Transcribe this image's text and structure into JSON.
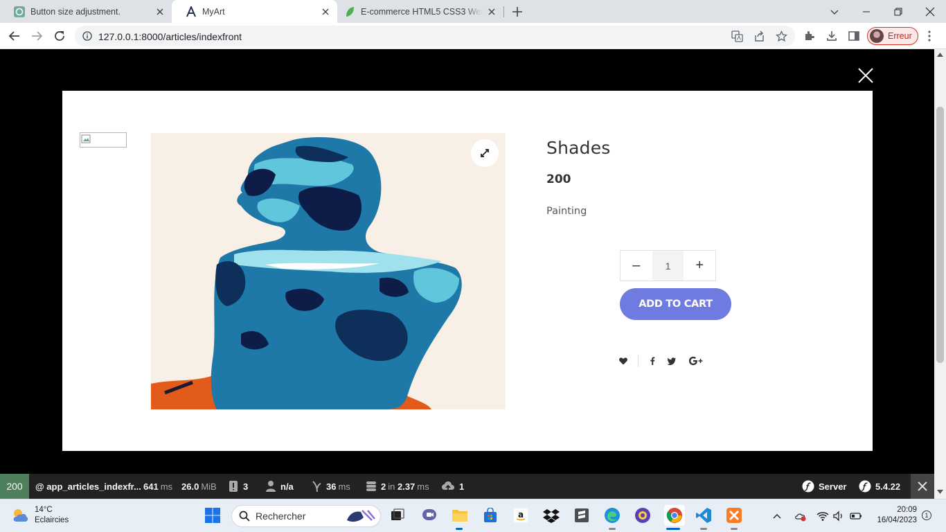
{
  "browser": {
    "tabs": [
      {
        "title": "Button size adjustment.",
        "icon": "chatgpt-icon"
      },
      {
        "title": "MyArt",
        "icon": "myart-icon"
      },
      {
        "title": "E-commerce HTML5 CSS3 Website",
        "icon": "leaf-icon"
      }
    ],
    "url_host": "127.0.0.1",
    "url_path": ":8000/articles/indexfront",
    "profile_label": "Erreur"
  },
  "product": {
    "title": "Shades",
    "price": "200",
    "category": "Painting",
    "quantity": "1",
    "minus_label": "–",
    "plus_label": "+",
    "add_to_cart_label": "ADD TO CART"
  },
  "devbar": {
    "status": "200",
    "route": "@ app_articles_indexfr...",
    "time_value": "641",
    "time_unit": "ms",
    "memory_value": "26.0",
    "memory_unit": "MiB",
    "logs_count": "3",
    "user": "n/a",
    "twig_value": "36",
    "twig_unit": "ms",
    "db_queries": "2",
    "db_in": "in",
    "db_time": "2.37",
    "db_unit": "ms",
    "http_count": "1",
    "server_label": "Server",
    "version": "5.4.22"
  },
  "taskbar": {
    "temperature": "14°C",
    "weather_text": "Eclaircies",
    "search_placeholder": "Rechercher",
    "time": "20:09",
    "date": "16/04/2023",
    "notification_count": "1"
  },
  "colors": {
    "accent_button": "#6f7be0",
    "devbar_status_ok": "#4f805d",
    "profile_error": "#d93025"
  }
}
